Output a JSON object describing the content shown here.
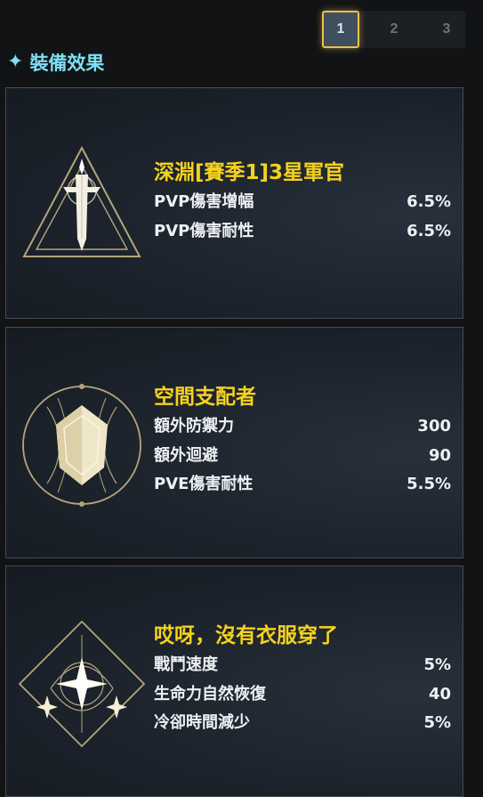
{
  "pagination": {
    "pages": [
      "1",
      "2",
      "3"
    ],
    "active": "1"
  },
  "section": {
    "title": "裝備效果"
  },
  "effects": [
    {
      "title": "深淵[賽季1]3星軍官",
      "icon": "sword-triangle-icon",
      "stats": [
        {
          "label": "PVP傷害增幅",
          "value": "6.5%"
        },
        {
          "label": "PVP傷害耐性",
          "value": "6.5%"
        }
      ]
    },
    {
      "title": "空間支配者",
      "icon": "shield-circle-icon",
      "stats": [
        {
          "label": "額外防禦力",
          "value": "300"
        },
        {
          "label": "額外迴避",
          "value": "90"
        },
        {
          "label": "PVE傷害耐性",
          "value": "5.5%"
        }
      ]
    },
    {
      "title": "哎呀，沒有衣服穿了",
      "icon": "star-diamond-icon",
      "stats": [
        {
          "label": "戰鬥速度",
          "value": "5%"
        },
        {
          "label": "生命力自然恢復",
          "value": "40"
        },
        {
          "label": "冷卻時間減少",
          "value": "5%"
        }
      ]
    }
  ],
  "colors": {
    "title": "#f5d21f",
    "section": "#7fdff4",
    "active_border": "#e9c04a"
  }
}
